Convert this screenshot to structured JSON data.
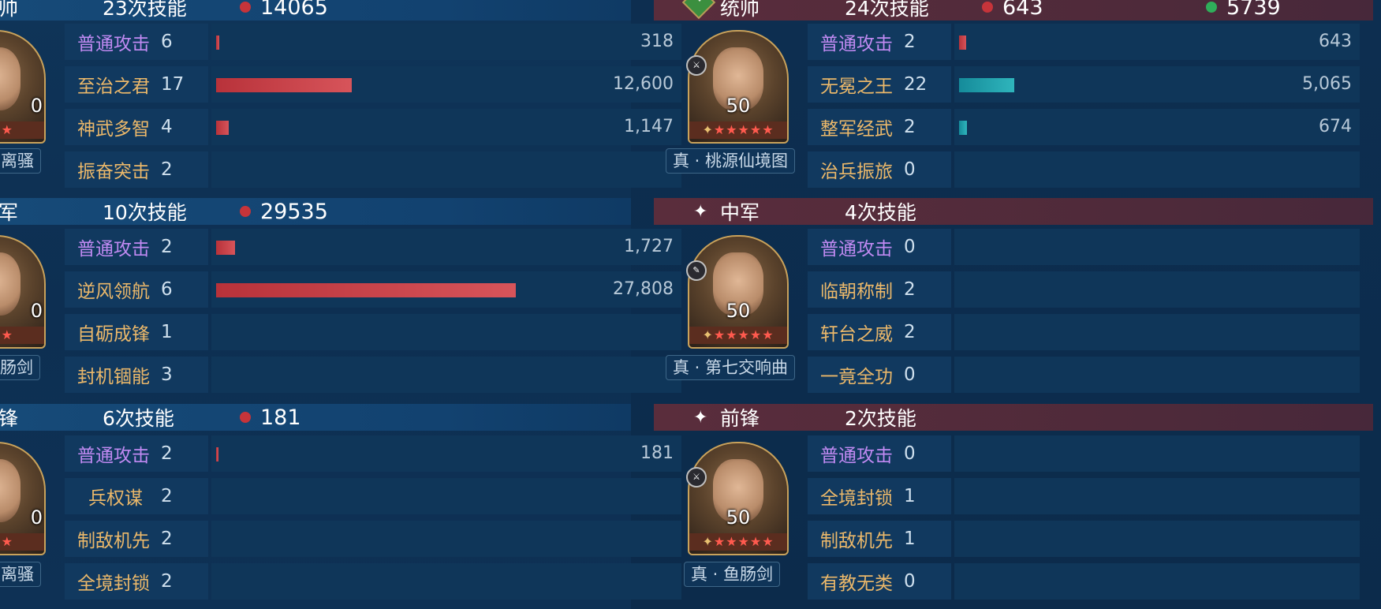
{
  "left": {
    "sections": [
      {
        "role": "帅",
        "skill_count": "23次技能",
        "damage": "14065",
        "hero_level": "0",
        "tag": "离骚",
        "skills": [
          {
            "name": "普通攻击",
            "count": "6",
            "value": "318",
            "color": "purple"
          },
          {
            "name": "至治之君",
            "count": "17",
            "value": "12,600",
            "color": "orange"
          },
          {
            "name": "神武多智",
            "count": "4",
            "value": "1,147",
            "color": "orange"
          },
          {
            "name": "振奋突击",
            "count": "2",
            "value": "",
            "color": "orange"
          }
        ]
      },
      {
        "role": "军",
        "skill_count": "10次技能",
        "damage": "29535",
        "hero_level": "0",
        "tag": "鱼肠剑",
        "skills": [
          {
            "name": "普通攻击",
            "count": "2",
            "value": "1,727",
            "color": "purple"
          },
          {
            "name": "逆风领航",
            "count": "6",
            "value": "27,808",
            "color": "orange"
          },
          {
            "name": "自砺成锋",
            "count": "1",
            "value": "",
            "color": "orange"
          },
          {
            "name": "封机锢能",
            "count": "3",
            "value": "",
            "color": "orange"
          }
        ]
      },
      {
        "role": "锋",
        "skill_count": "6次技能",
        "damage": "181",
        "hero_level": "0",
        "tag": "离骚",
        "skills": [
          {
            "name": "普通攻击",
            "count": "2",
            "value": "181",
            "color": "purple"
          },
          {
            "name": "兵权谋",
            "count": "2",
            "value": "",
            "color": "orange"
          },
          {
            "name": "制敌机先",
            "count": "2",
            "value": "",
            "color": "orange"
          },
          {
            "name": "全境封锁",
            "count": "2",
            "value": "",
            "color": "orange"
          }
        ]
      }
    ]
  },
  "right": {
    "sections": [
      {
        "role": "统帅",
        "skill_count": "24次技能",
        "damage": "643",
        "heal": "5739",
        "hero_level": "50",
        "tag": "真 · 桃源仙境图",
        "skills": [
          {
            "name": "普通攻击",
            "count": "2",
            "value": "643",
            "color": "purple"
          },
          {
            "name": "无冕之王",
            "count": "22",
            "value": "5,065",
            "color": "orange"
          },
          {
            "name": "整军经武",
            "count": "2",
            "value": "674",
            "color": "orange"
          },
          {
            "name": "治兵振旅",
            "count": "0",
            "value": "",
            "color": "orange"
          }
        ]
      },
      {
        "role": "中军",
        "skill_count": "4次技能",
        "hero_level": "50",
        "tag": "真 · 第七交响曲",
        "skills": [
          {
            "name": "普通攻击",
            "count": "0",
            "value": "",
            "color": "purple"
          },
          {
            "name": "临朝称制",
            "count": "2",
            "value": "",
            "color": "orange"
          },
          {
            "name": "轩台之威",
            "count": "2",
            "value": "",
            "color": "orange"
          },
          {
            "name": "一竟全功",
            "count": "0",
            "value": "",
            "color": "orange"
          }
        ]
      },
      {
        "role": "前锋",
        "skill_count": "2次技能",
        "hero_level": "50",
        "tag": "真 · 鱼肠剑",
        "skills": [
          {
            "name": "普通攻击",
            "count": "0",
            "value": "",
            "color": "purple"
          },
          {
            "name": "全境封锁",
            "count": "1",
            "value": "",
            "color": "orange"
          },
          {
            "name": "制敌机先",
            "count": "1",
            "value": "",
            "color": "orange"
          },
          {
            "name": "有教无类",
            "count": "0",
            "value": "",
            "color": "orange"
          }
        ]
      }
    ]
  },
  "colors": {
    "damage_dot": "#c6343a",
    "heal_dot": "#2fae5a",
    "left_bar": "#c23a41",
    "right_bar": "#2fb5bc",
    "basic_attack_text": "#c08af2",
    "skill_text": "#ebb86a"
  },
  "icons": {
    "right_commander_badge": "green-diamond-heart-icon",
    "section_marker": "sparkle-icon"
  }
}
